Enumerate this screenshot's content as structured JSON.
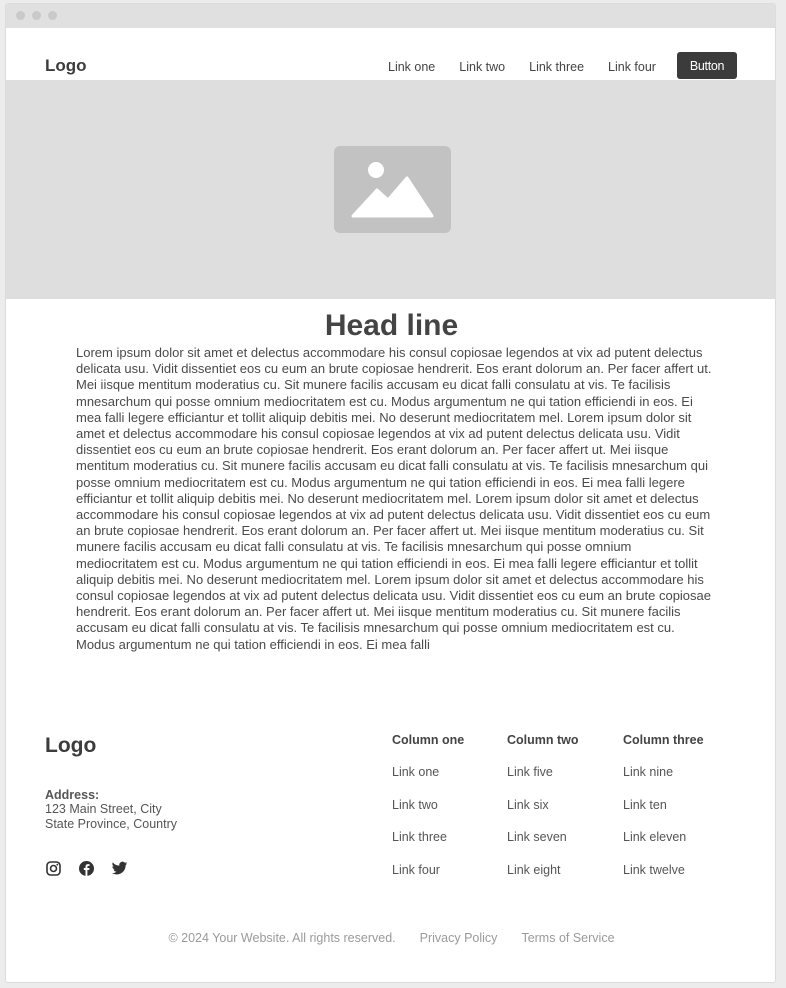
{
  "header": {
    "logo": "Logo",
    "nav": [
      "Link one",
      "Link two",
      "Link three",
      "Link four"
    ],
    "button": "Button"
  },
  "hero": {
    "image_icon": "image-placeholder-icon"
  },
  "main": {
    "headline": "Head line",
    "body": "Lorem ipsum dolor sit amet et delectus accommodare his consul copiosae legendos at vix ad putent delectus delicata usu. Vidit dissentiet eos cu eum an brute copiosae hendrerit. Eos erant dolorum an. Per facer affert ut. Mei iisque mentitum moderatius cu. Sit munere facilis accusam eu dicat falli consulatu at vis. Te facilisis mnesarchum qui posse omnium mediocritatem est cu. Modus argumentum ne qui tation efficiendi in eos. Ei mea falli legere efficiantur et tollit aliquip debitis mei. No deserunt mediocritatem mel. Lorem ipsum dolor sit amet et delectus accommodare his consul copiosae legendos at vix ad putent delectus delicata usu. Vidit dissentiet eos cu eum an brute copiosae hendrerit. Eos erant dolorum an. Per facer affert ut. Mei iisque mentitum moderatius cu. Sit munere facilis accusam eu dicat falli consulatu at vis. Te facilisis mnesarchum qui posse omnium mediocritatem est cu. Modus argumentum ne qui tation efficiendi in eos. Ei mea falli legere efficiantur et tollit aliquip debitis mei. No deserunt mediocritatem mel. Lorem ipsum dolor sit amet et delectus accommodare his consul copiosae legendos at vix ad putent delectus delicata usu. Vidit dissentiet eos cu eum an brute copiosae hendrerit. Eos erant dolorum an. Per facer affert ut. Mei iisque mentitum moderatius cu. Sit munere facilis accusam eu dicat falli consulatu at vis. Te facilisis mnesarchum qui posse omnium mediocritatem est cu. Modus argumentum ne qui tation efficiendi in eos. Ei mea falli legere efficiantur et tollit aliquip debitis mei. No deserunt mediocritatem mel. Lorem ipsum dolor sit amet et delectus accommodare his consul copiosae legendos at vix ad putent delectus delicata usu. Vidit dissentiet eos cu eum an brute copiosae hendrerit. Eos erant dolorum an. Per facer affert ut. Mei iisque mentitum moderatius cu. Sit munere facilis accusam eu dicat falli consulatu at vis. Te facilisis mnesarchum qui posse omnium mediocritatem est cu. Modus argumentum ne qui tation efficiendi in eos. Ei mea falli"
  },
  "footer": {
    "logo": "Logo",
    "address_label": "Address:",
    "address_line1": "123 Main Street, City",
    "address_line2": "State Province, Country",
    "social_icons": [
      "instagram-icon",
      "facebook-icon",
      "twitter-icon"
    ],
    "columns": [
      {
        "title": "Column one",
        "links": [
          "Link one",
          "Link two",
          "Link three",
          "Link four"
        ]
      },
      {
        "title": "Column two",
        "links": [
          "Link five",
          "Link six",
          "Link seven",
          "Link eight"
        ]
      },
      {
        "title": "Column three",
        "links": [
          "Link nine",
          "Link ten",
          "Link eleven",
          "Link twelve"
        ]
      }
    ],
    "copyright": "© 2024 Your Website. All rights reserved.",
    "privacy": "Privacy Policy",
    "terms": "Terms of Service"
  },
  "colors": {
    "button_bg": "#3b3b3b",
    "hero_bg": "#dedede",
    "placeholder": "#c2c2c2"
  }
}
